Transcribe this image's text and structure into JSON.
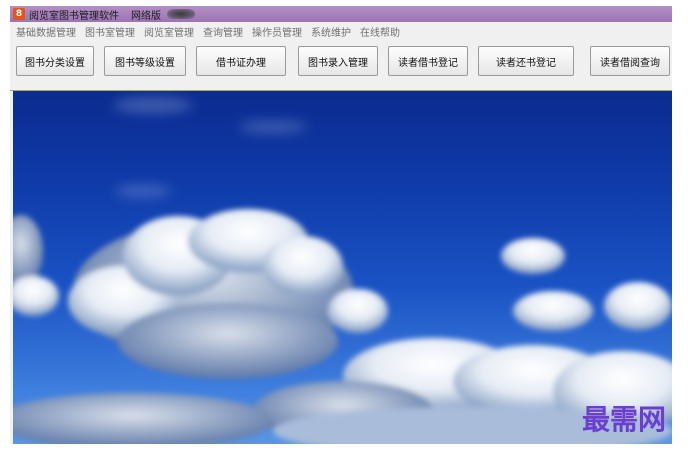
{
  "window": {
    "title": "阅览室图书管理软件",
    "edition": "网络版",
    "icon": "app-logo-icon",
    "icon_glyph": "8"
  },
  "menu": {
    "items": [
      {
        "label": "基础数据管理"
      },
      {
        "label": "图书室管理"
      },
      {
        "label": "阅览室管理"
      },
      {
        "label": "查询管理"
      },
      {
        "label": "操作员管理"
      },
      {
        "label": "系统维护"
      },
      {
        "label": "在线帮助"
      }
    ]
  },
  "toolbar": {
    "buttons": [
      {
        "label": "图书分类设置"
      },
      {
        "label": "图书等级设置"
      },
      {
        "label": "借书证办理"
      },
      {
        "label": "图书录入管理"
      },
      {
        "label": "读者借书登记"
      },
      {
        "label": "读者还书登记"
      },
      {
        "label": "读者借阅查询"
      }
    ]
  },
  "content": {
    "background": "sky-with-clouds",
    "watermark": "最需网"
  },
  "colors": {
    "titlebar": "#9c74b2",
    "sky_top": "#0b2b8f",
    "sky_bottom": "#5a96e6",
    "watermark": "#6a3fd0"
  }
}
